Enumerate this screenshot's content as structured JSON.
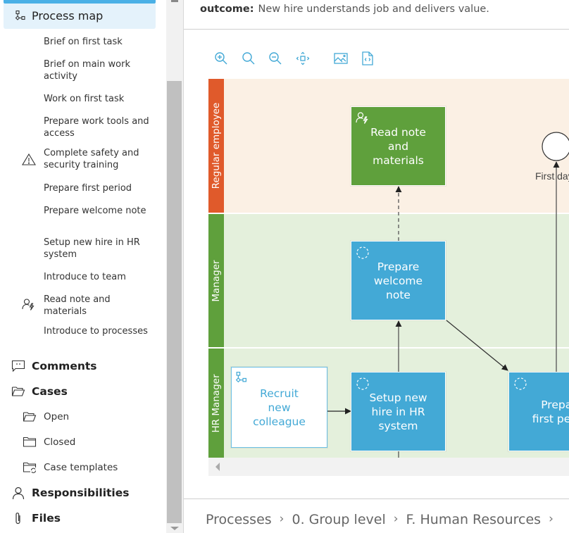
{
  "sidebar": {
    "active_item": {
      "label": "Process map",
      "icon": "process-map-icon"
    },
    "sub_items": [
      {
        "label": "Brief on first task",
        "icon": null
      },
      {
        "label": "Brief on main work activity",
        "icon": null
      },
      {
        "label": "Work on first task",
        "icon": null
      },
      {
        "label": "Prepare work tools and access",
        "icon": null
      },
      {
        "label": "Complete safety and security training",
        "icon": "warning-icon"
      },
      {
        "label": "Prepare first period",
        "icon": null
      },
      {
        "label": "Prepare welcome note",
        "icon": null
      },
      {
        "label": "Setup new hire in HR system",
        "icon": null
      },
      {
        "label": "Introduce to team",
        "icon": null
      },
      {
        "label": "Read note and materials",
        "icon": "user-action-icon"
      },
      {
        "label": "Introduce to processes",
        "icon": null
      }
    ],
    "comments_label": "Comments",
    "cases_label": "Cases",
    "cases_items": [
      {
        "label": "Open",
        "icon": "folder-open-icon"
      },
      {
        "label": "Closed",
        "icon": "folder-closed-icon"
      },
      {
        "label": "Case templates",
        "icon": "folder-template-icon"
      }
    ],
    "responsibilities_label": "Responsibilities",
    "files_label": "Files"
  },
  "main": {
    "outcome_label": "outcome:",
    "outcome_value": "New hire understands job and delivers value.",
    "toolbar": [
      {
        "name": "zoom-in",
        "icon": "zoom-in-icon"
      },
      {
        "name": "zoom-reset",
        "icon": "zoom-icon"
      },
      {
        "name": "zoom-out",
        "icon": "zoom-out-icon"
      },
      {
        "name": "fit",
        "icon": "move-fit-icon"
      },
      {
        "name": "export-image",
        "icon": "image-icon"
      },
      {
        "name": "export-code",
        "icon": "code-file-icon"
      }
    ],
    "diagram": {
      "lanes": [
        {
          "label": "Regular employee",
          "color": "#e05a2b",
          "bg": "#fbf0e4"
        },
        {
          "label": "Manager",
          "color": "#5fa03c",
          "bg": "#e4f0dc"
        },
        {
          "label": "HR Manager",
          "color": "#5fa03c",
          "bg": "#e4f0dc"
        }
      ],
      "tasks": {
        "read_note": "Read note and materials",
        "prepare_welcome": "Prepare welcome note",
        "setup_hr": "Setup new hire in HR system",
        "recruit": "Recruit new colleague",
        "prepare_first": "Prepare first period"
      },
      "event_label": "First day"
    },
    "breadcrumb": [
      "Processes",
      "0. Group level",
      "F. Human Resources"
    ]
  },
  "colors": {
    "accent": "#43a9d6",
    "green": "#5fa03c",
    "orange": "#e05a2b"
  }
}
